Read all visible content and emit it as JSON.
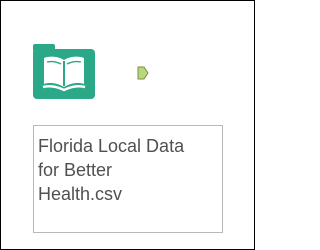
{
  "workflow_canvas": {
    "tool": {
      "icon": "input-data-book-icon",
      "icon_color": "#2aa888",
      "output_anchor_color": "#b7d97c",
      "label_lines": [
        "Florida Local Data",
        "for Better",
        "Health.csv"
      ]
    }
  }
}
